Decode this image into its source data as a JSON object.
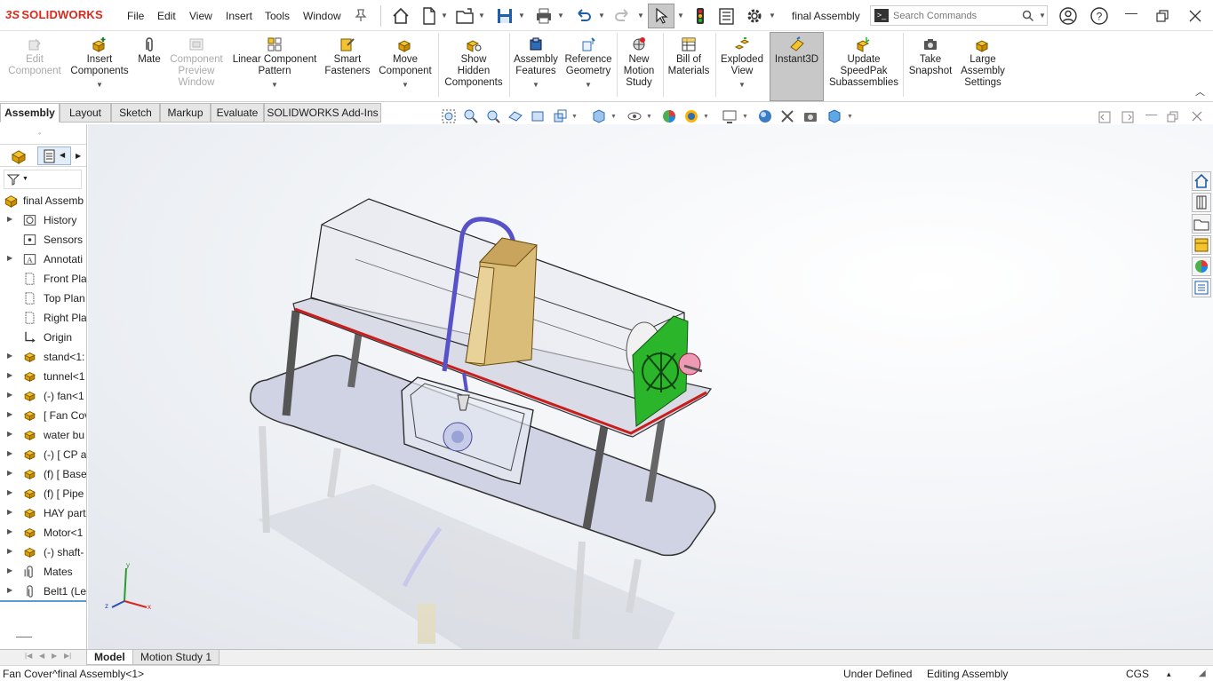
{
  "app": {
    "brand_ds": "3S",
    "brand_name": "SOLIDWORKS",
    "doc_title": "final Assembly"
  },
  "menu": [
    "File",
    "Edit",
    "View",
    "Insert",
    "Tools",
    "Window"
  ],
  "search": {
    "placeholder": "Search Commands"
  },
  "ribbon": {
    "edit_component": "Edit\nComponent",
    "insert_components": "Insert\nComponents",
    "mate": "Mate",
    "component_preview": "Component\nPreview\nWindow",
    "linear_pattern": "Linear Component\nPattern",
    "smart_fasteners": "Smart\nFasteners",
    "move_component": "Move\nComponent",
    "show_hidden": "Show\nHidden\nComponents",
    "assembly_features": "Assembly\nFeatures",
    "reference_geometry": "Reference\nGeometry",
    "new_motion_study": "New\nMotion\nStudy",
    "bill_of_materials": "Bill of\nMaterials",
    "exploded_view": "Exploded\nView",
    "instant3d": "Instant3D",
    "update_speedpak": "Update\nSpeedPak\nSubassemblies",
    "take_snapshot": "Take\nSnapshot",
    "large_assembly": "Large\nAssembly\nSettings"
  },
  "tabs": [
    "Assembly",
    "Layout",
    "Sketch",
    "Markup",
    "Evaluate",
    "SOLIDWORKS Add-Ins"
  ],
  "tree": [
    {
      "label": "final Assemb",
      "icon": "assembly-icon",
      "expand": ""
    },
    {
      "label": "History",
      "icon": "history-icon",
      "expand": "▶"
    },
    {
      "label": "Sensors",
      "icon": "sensors-icon",
      "expand": ""
    },
    {
      "label": "Annotati",
      "icon": "annotations-icon",
      "expand": "▶"
    },
    {
      "label": "Front Pla",
      "icon": "plane-icon",
      "expand": ""
    },
    {
      "label": "Top Plan",
      "icon": "plane-icon",
      "expand": ""
    },
    {
      "label": "Right Pla",
      "icon": "plane-icon",
      "expand": ""
    },
    {
      "label": "Origin",
      "icon": "origin-icon",
      "expand": ""
    },
    {
      "label": "stand<1:",
      "icon": "part-icon",
      "expand": "▶"
    },
    {
      "label": "tunnel<1",
      "icon": "part-icon",
      "expand": "▶"
    },
    {
      "label": "(-) fan<1",
      "icon": "part-icon",
      "expand": "▶"
    },
    {
      "label": "[ Fan Cov",
      "icon": "part-icon",
      "expand": "▶"
    },
    {
      "label": "water bu",
      "icon": "part-icon",
      "expand": "▶"
    },
    {
      "label": "(-) [ CP a",
      "icon": "part-icon",
      "expand": "▶"
    },
    {
      "label": "(f) [ Base",
      "icon": "part-icon",
      "expand": "▶"
    },
    {
      "label": "(f) [ Pipe",
      "icon": "part-icon",
      "expand": "▶"
    },
    {
      "label": "HAY part",
      "icon": "part-icon",
      "expand": "▶"
    },
    {
      "label": "Motor<1",
      "icon": "part-icon",
      "expand": "▶"
    },
    {
      "label": "(-) shaft-",
      "icon": "part-icon",
      "expand": "▶"
    },
    {
      "label": "Mates",
      "icon": "mates-icon",
      "expand": "▶"
    },
    {
      "label": "Belt1 (Le",
      "icon": "belt-icon",
      "expand": "▶"
    }
  ],
  "triad": {
    "x": "x",
    "y": "y",
    "z": "z"
  },
  "bottom_tabs": [
    "Model",
    "Motion Study 1"
  ],
  "status": {
    "selection": "Fan Cover^final Assembly<1>",
    "definition": "Under Defined",
    "mode": "Editing Assembly",
    "units": "CGS",
    "units_caret": "▴"
  },
  "colors": {
    "brand": "#d52b1e",
    "viewport_bg": "#eef1f5",
    "accent_green": "#2bb52b",
    "table_red": "#c81e1e"
  }
}
